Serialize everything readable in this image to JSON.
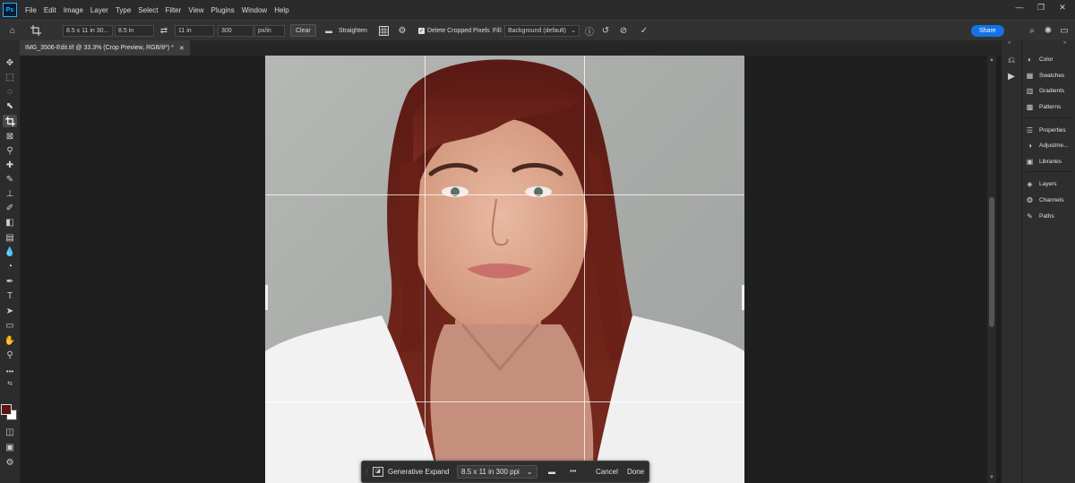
{
  "menu": {
    "logo": "Ps",
    "items": [
      "File",
      "Edit",
      "Image",
      "Layer",
      "Type",
      "Select",
      "Filter",
      "View",
      "Plugins",
      "Window",
      "Help"
    ]
  },
  "window_controls": {
    "minimize": "—",
    "maximize": "❐",
    "close": "✕"
  },
  "options_bar": {
    "preset": "8.5 x 11 in 30...",
    "width": "8.5 in",
    "height": "11 in",
    "resolution": "300",
    "resolution_unit": "px/in",
    "clear_label": "Clear",
    "straighten_label": "Straighten",
    "delete_cropped_label": "Delete Cropped Pixels",
    "delete_cropped_checked": true,
    "fill_label": "Fill:",
    "fill_value": "Background (default)",
    "share_label": "Share"
  },
  "document": {
    "tab_title": "IMG_3506-Edit.tif @ 33.3% (Crop Preview, RGB/8*) *",
    "close_symbol": "✕"
  },
  "taskbar": {
    "generative_expand_label": "Generative Expand",
    "preset_value": "8.5 x 11 in 300 ppi",
    "more_label": "•••",
    "cancel_label": "Cancel",
    "done_label": "Done"
  },
  "panels": {
    "group1": [
      {
        "label": "Color",
        "icon": "color-palette-icon"
      },
      {
        "label": "Swatches",
        "icon": "swatches-icon"
      },
      {
        "label": "Gradients",
        "icon": "gradients-icon"
      },
      {
        "label": "Patterns",
        "icon": "patterns-icon"
      }
    ],
    "group2": [
      {
        "label": "Properties",
        "icon": "properties-icon"
      },
      {
        "label": "Adjustme...",
        "icon": "adjustments-icon"
      },
      {
        "label": "Libraries",
        "icon": "libraries-icon"
      }
    ],
    "group3": [
      {
        "label": "Layers",
        "icon": "layers-icon"
      },
      {
        "label": "Channels",
        "icon": "channels-icon"
      },
      {
        "label": "Paths",
        "icon": "paths-icon"
      }
    ]
  },
  "colors": {
    "accent": "#1473e6",
    "foreground_swatch": "#5a1414",
    "background_swatch": "#ffffff"
  }
}
